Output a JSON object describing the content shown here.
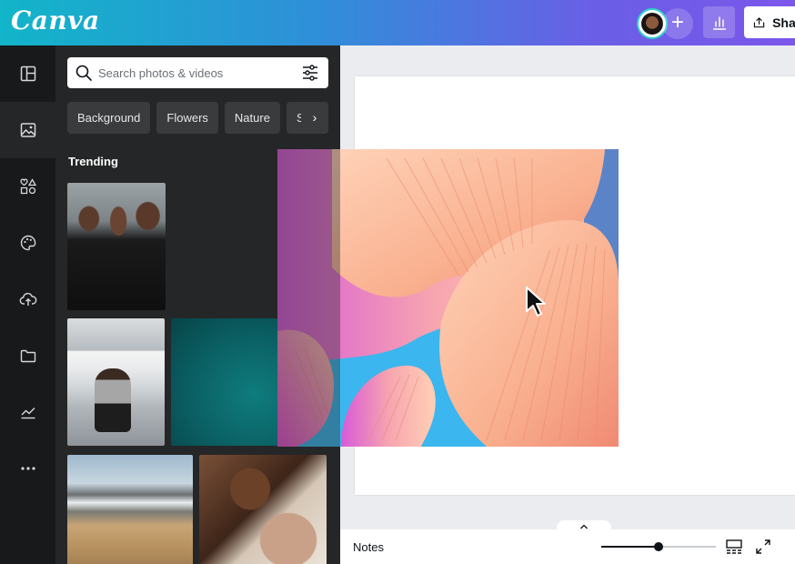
{
  "app": {
    "logo_text": "Canva"
  },
  "header": {
    "share_label": "Share",
    "icons": {
      "add": "plus-icon",
      "insights": "bar-chart-icon",
      "share": "upload-icon"
    },
    "gradient_colors": [
      "#12b5c9",
      "#6a5ee6",
      "#7b57ea"
    ]
  },
  "rail": {
    "items": [
      {
        "name": "templates",
        "icon": "layout-icon",
        "active": false
      },
      {
        "name": "photos",
        "icon": "image-icon",
        "active": true
      },
      {
        "name": "elements",
        "icon": "shapes-icon",
        "active": false
      },
      {
        "name": "brand",
        "icon": "palette-icon",
        "active": false
      },
      {
        "name": "uploads",
        "icon": "cloud-upload-icon",
        "active": false
      },
      {
        "name": "projects",
        "icon": "folder-icon",
        "active": false
      },
      {
        "name": "charts",
        "icon": "line-chart-icon",
        "active": false
      },
      {
        "name": "more",
        "icon": "more-icon",
        "active": false
      }
    ]
  },
  "panel": {
    "search": {
      "placeholder": "Search photos & videos",
      "value": ""
    },
    "chips": [
      "Background",
      "Flowers",
      "Nature",
      "Sur"
    ],
    "section_title": "Trending"
  },
  "bottom_bar": {
    "notes_label": "Notes",
    "zoom_fraction": 0.5
  }
}
